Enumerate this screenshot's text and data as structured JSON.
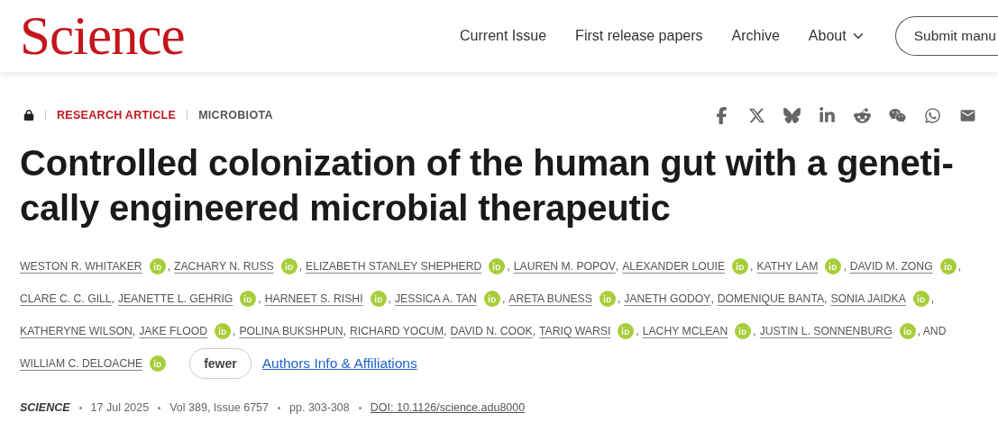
{
  "header": {
    "logo": "Science",
    "nav": [
      {
        "label": "Current Issue",
        "dropdown": false
      },
      {
        "label": "First release papers",
        "dropdown": false
      },
      {
        "label": "Archive",
        "dropdown": false
      },
      {
        "label": "About",
        "dropdown": true
      }
    ],
    "submit_button": "Submit manu"
  },
  "article": {
    "locked": true,
    "type": "RESEARCH ARTICLE",
    "subject": "MICROBIOTA",
    "share": [
      {
        "kind": "facebook"
      },
      {
        "kind": "x"
      },
      {
        "kind": "bluesky"
      },
      {
        "kind": "linkedin"
      },
      {
        "kind": "reddit"
      },
      {
        "kind": "wechat"
      },
      {
        "kind": "whatsapp"
      },
      {
        "kind": "email"
      }
    ],
    "title_lines": [
      "Controlled colonization of the human gut with a geneti-",
      "cally engineered microbial therapeutic"
    ],
    "author_lines": [
      [
        {
          "name": "WESTON R. WHITAKER",
          "orcid": true,
          "after": ","
        },
        {
          "name": "ZACHARY N. RUSS",
          "orcid": true,
          "after": ","
        },
        {
          "name": "ELIZABETH STANLEY SHEPHERD",
          "orcid": true,
          "after": ","
        },
        {
          "name": "LAUREN M. POPOV",
          "orcid": false,
          "after": ","
        },
        {
          "name": "ALEXANDER LOUIE",
          "orcid": true,
          "after": ","
        },
        {
          "name": "KATHY LAM",
          "orcid": true,
          "after": ","
        },
        {
          "name": "DAVID M. ZONG",
          "orcid": true,
          "after": ","
        }
      ],
      [
        {
          "name": "CLARE C. C. GILL",
          "orcid": false,
          "after": ","
        },
        {
          "name": "JEANETTE L. GEHRIG",
          "orcid": true,
          "after": ","
        },
        {
          "name": "HARNEET S. RISHI",
          "orcid": true,
          "after": ","
        },
        {
          "name": "JESSICA A. TAN",
          "orcid": true,
          "after": ","
        },
        {
          "name": "ARETA BUNESS",
          "orcid": true,
          "after": ","
        },
        {
          "name": "JANETH GODOY",
          "orcid": false,
          "after": ","
        },
        {
          "name": "DOMENIQUE BANTA",
          "orcid": false,
          "after": ","
        },
        {
          "name": "SONIA JAIDKA",
          "orcid": true,
          "after": ","
        }
      ],
      [
        {
          "name": "KATHERYNE WILSON",
          "orcid": false,
          "after": ","
        },
        {
          "name": "JAKE FLOOD",
          "orcid": true,
          "after": ","
        },
        {
          "name": "POLINA BUKSHPUN",
          "orcid": false,
          "after": ","
        },
        {
          "name": "RICHARD YOCUM",
          "orcid": false,
          "after": ","
        },
        {
          "name": "DAVID N. COOK",
          "orcid": false,
          "after": ","
        },
        {
          "name": "TARIQ WARSI",
          "orcid": true,
          "after": ","
        },
        {
          "name": "LACHY MCLEAN",
          "orcid": true,
          "after": ","
        },
        {
          "name": "JUSTIN L. SONNENBURG",
          "orcid": true,
          "after": ", AND"
        }
      ],
      [
        {
          "name": "WILLIAM C. DELOACHE",
          "orcid": true
        }
      ]
    ],
    "fewer_button": "fewer",
    "affiliations_link": "Authors Info & Affiliations",
    "citation": {
      "journal": "SCIENCE",
      "date": "17 Jul 2025",
      "volume": "Vol 389, Issue 6757",
      "pages": "pp. 303-308",
      "doi": "DOI: 10.1126/science.adu8000"
    }
  }
}
